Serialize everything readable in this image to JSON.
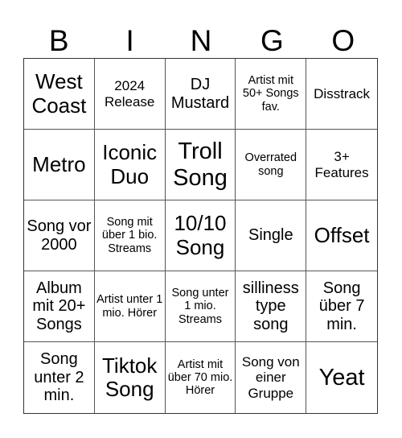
{
  "header": [
    "B",
    "I",
    "N",
    "G",
    "O"
  ],
  "cells": [
    {
      "text": "West Coast",
      "size": "s-l"
    },
    {
      "text": "2024 Release",
      "size": "s-s"
    },
    {
      "text": "DJ Mustard",
      "size": "s-m"
    },
    {
      "text": "Artist mit 50+ Songs fav.",
      "size": "s-xs"
    },
    {
      "text": "Disstrack",
      "size": "s-s"
    },
    {
      "text": "Metro",
      "size": "s-l"
    },
    {
      "text": "Iconic Duo",
      "size": "s-l"
    },
    {
      "text": "Troll Song",
      "size": "s-xl"
    },
    {
      "text": "Overrated song",
      "size": "s-xs"
    },
    {
      "text": "3+ Features",
      "size": "s-s"
    },
    {
      "text": "Song vor 2000",
      "size": "s-m"
    },
    {
      "text": "Song mit über 1 bio. Streams",
      "size": "s-xs"
    },
    {
      "text": "10/10 Song",
      "size": "s-l"
    },
    {
      "text": "Single",
      "size": "s-m"
    },
    {
      "text": "Offset",
      "size": "s-l"
    },
    {
      "text": "Album mit 20+ Songs",
      "size": "s-m"
    },
    {
      "text": "Artist unter 1 mio. Hörer",
      "size": "s-xs"
    },
    {
      "text": "Song unter 1 mio. Streams",
      "size": "s-xs"
    },
    {
      "text": "silliness type song",
      "size": "s-m"
    },
    {
      "text": "Song über 7 min.",
      "size": "s-m"
    },
    {
      "text": "Song unter 2 min.",
      "size": "s-m"
    },
    {
      "text": "Tiktok Song",
      "size": "s-l"
    },
    {
      "text": "Artist mit über 70 mio. Hörer",
      "size": "s-xs"
    },
    {
      "text": "Song von einer Gruppe",
      "size": "s-s"
    },
    {
      "text": "Yeat",
      "size": "s-xl"
    }
  ]
}
